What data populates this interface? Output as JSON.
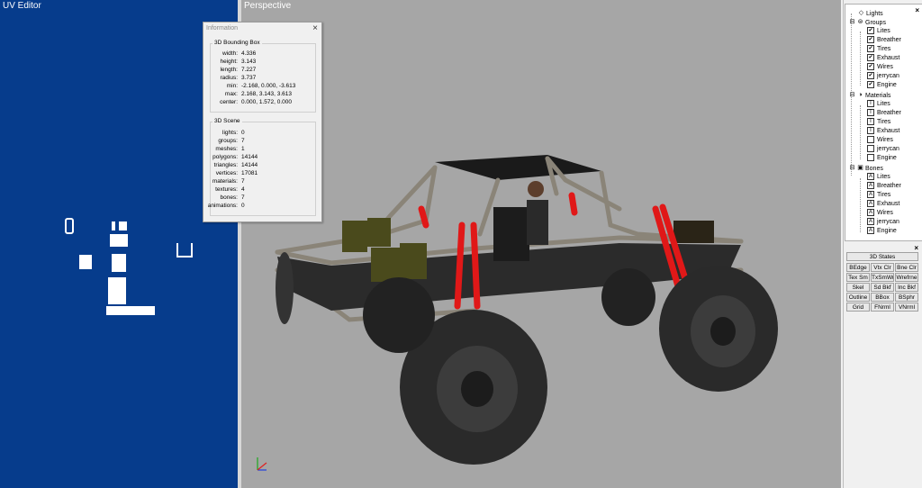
{
  "uv_editor": {
    "title": "UV Editor"
  },
  "perspective": {
    "title": "Perspective"
  },
  "info_window": {
    "title": "Information",
    "close_glyph": "×",
    "bbox_title": "3D Bounding Box",
    "bbox": [
      {
        "label": "width:",
        "value": "4.336"
      },
      {
        "label": "height:",
        "value": "3.143"
      },
      {
        "label": "length:",
        "value": "7.227"
      },
      {
        "label": "radius:",
        "value": "3.737"
      },
      {
        "label": "min:",
        "value": "-2.168, 0.000, -3.613"
      },
      {
        "label": "max:",
        "value": "2.168, 3.143, 3.613"
      },
      {
        "label": "center:",
        "value": "0.000, 1.572, 0.000"
      }
    ],
    "scene_title": "3D Scene",
    "scene": [
      {
        "label": "lights:",
        "value": "0"
      },
      {
        "label": "groups:",
        "value": "7"
      },
      {
        "label": "meshes:",
        "value": "1"
      },
      {
        "label": "polygons:",
        "value": "14144"
      },
      {
        "label": "triangles:",
        "value": "14144"
      },
      {
        "label": "vertices:",
        "value": "17081"
      },
      {
        "label": "materials:",
        "value": "7"
      },
      {
        "label": "textures:",
        "value": "4"
      },
      {
        "label": "bones:",
        "value": "7"
      },
      {
        "label": "animations:",
        "value": "0"
      }
    ]
  },
  "tree": {
    "close_glyph": "×",
    "lights_label": "Lights",
    "groups_label": "Groups",
    "groups": [
      "Lites",
      "Breather",
      "Tires",
      "Exhaust",
      "Wires",
      "jerrycan",
      "Engine"
    ],
    "materials_label": "Materials",
    "materials": [
      "Lites",
      "Breather",
      "Tires",
      "Exhaust",
      "Wires",
      "jerrycan",
      "Engine"
    ],
    "bones_label": "Bones",
    "bones": [
      "Lites",
      "Breather",
      "Tires",
      "Exhaust",
      "Wires",
      "jerrycan",
      "Engine"
    ],
    "checked_glyph": "✔",
    "textured_glyph": "T",
    "bone_glyph": "A"
  },
  "states": {
    "close_glyph": "×",
    "header": "3D States",
    "buttons": [
      [
        "BEdge",
        "Vtx Clr",
        "Bne Clr"
      ],
      [
        "Tex Sm",
        "TxSmWr",
        "Wrefrne"
      ],
      [
        "Skel",
        "Sd Bkf",
        "Inc Bkf"
      ],
      [
        "Outline",
        "BBox",
        "BSphr"
      ],
      [
        "Grid",
        "FNrml",
        "VNrml"
      ]
    ]
  },
  "colors": {
    "uv_bg": "#063c8c",
    "viewport_bg": "#a6a6a6",
    "roll_cage": "#8a8478",
    "red_bars": "#e01818",
    "tire": "#2a2a2a",
    "jerrycan": "#4a4a1c"
  }
}
